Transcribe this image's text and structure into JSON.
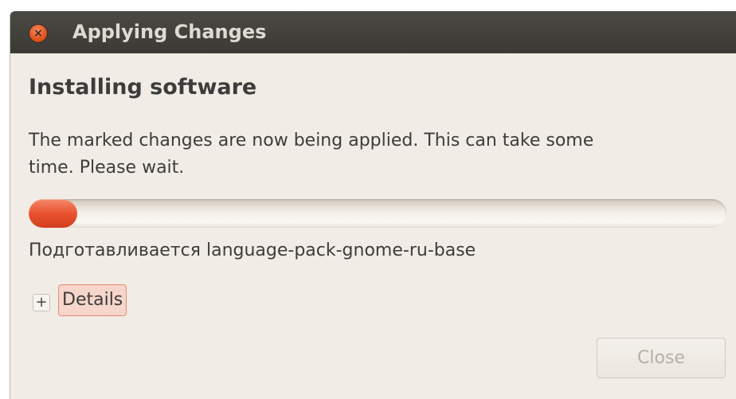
{
  "window": {
    "title": "Applying Changes",
    "close_symbol": "×"
  },
  "content": {
    "heading": "Installing software",
    "message": "The marked changes are now being applied. This can take some time. Please wait.",
    "progress": 0.07,
    "status": "Подготавливается language-pack-gnome-ru-base",
    "expander_symbol": "+",
    "details_label": "Details"
  },
  "buttons": {
    "close_label": "Close"
  },
  "colors": {
    "titlebar": "#3f3e3a",
    "window_background": "#f1ede6",
    "accent_orange": "#ea5230",
    "disabled_text": "#b5b0a7"
  },
  "icons": {
    "window_close": "close-icon",
    "expander": "plus-icon"
  }
}
